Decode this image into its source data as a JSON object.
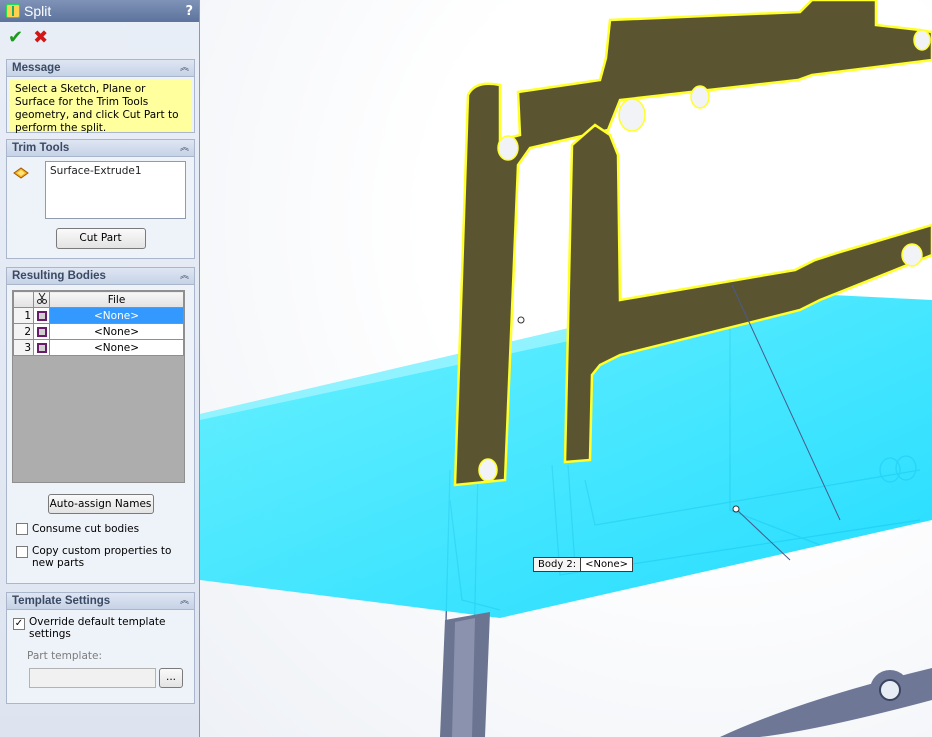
{
  "window": {
    "title": "Split",
    "help_symbol": "?"
  },
  "actions": {
    "ok_icon": "✔",
    "cancel_icon": "✖"
  },
  "message_group": {
    "header": "Message",
    "text": "Select a Sketch, Plane or Surface for the Trim Tools geometry, and click Cut Part to perform the split."
  },
  "trim_tools": {
    "header": "Trim Tools",
    "selected_item": "Surface-Extrude1",
    "cut_button": "Cut Part"
  },
  "resulting_bodies": {
    "header": "Resulting Bodies",
    "column_file": "File",
    "rows": [
      {
        "num": "1",
        "file": "<None>",
        "selected": true
      },
      {
        "num": "2",
        "file": "<None>",
        "selected": false
      },
      {
        "num": "3",
        "file": "<None>",
        "selected": false
      }
    ],
    "auto_assign_button": "Auto-assign Names",
    "consume_label": "Consume cut bodies",
    "copy_props_label": "Copy custom properties to new parts"
  },
  "template_settings": {
    "header": "Template Settings",
    "override_label": "Override default template settings",
    "override_checked": true,
    "part_template_label": "Part template:",
    "part_template_value": "",
    "browse_button": "..."
  },
  "viewport": {
    "body_callout_label": "Body  2:",
    "body_callout_value": "<None>"
  },
  "colors": {
    "plane": "#2fe6ff",
    "selected_part": "#5a5530",
    "highlight": "#ffff2a",
    "selection_blue": "#3399ff"
  }
}
